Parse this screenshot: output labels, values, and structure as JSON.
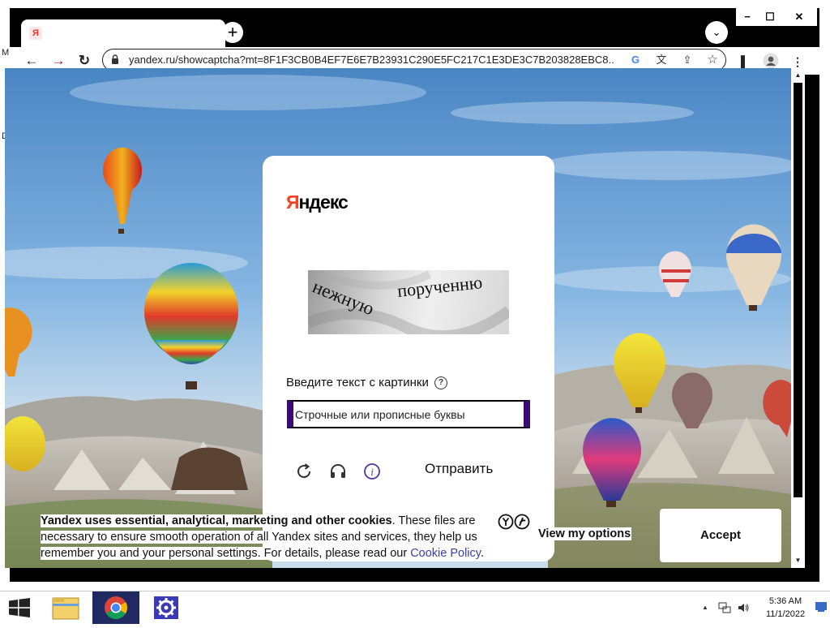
{
  "desktop": {
    "edge_letter_1": "M",
    "edge_letter_2": "D"
  },
  "window": {
    "tab_favicon_letter": "Я",
    "newtab_symbol": "+",
    "tabsearch_symbol": "⌄",
    "minimize_symbol": "−",
    "maximize_symbol": "☐",
    "close_symbol": "✕"
  },
  "toolbar": {
    "back_symbol": "←",
    "forward_symbol": "→",
    "reload_symbol": "↻",
    "url": "yandex.ru/showcaptcha?mt=8F1F3CB0B4EF7E6E7B23931C290E5FC217C1E3DE3C7B203828EBC8...",
    "google_symbol": "G",
    "translate_symbol": "文",
    "share_symbol": "⇪",
    "bookmark_symbol": "☆",
    "sidepanel_symbol": "▌",
    "menu_symbol": "⋮"
  },
  "captcha": {
    "logo_first": "Я",
    "logo_rest": "ндекс",
    "word_1": "нежную",
    "word_2": "порученню",
    "label": "Введите текст с картинки",
    "help_symbol": "?",
    "input_placeholder": "Строчные или прописные буквы",
    "input_value": "",
    "submit_label": "Отправить"
  },
  "cookie": {
    "bold_text": "Yandex uses essential, analytical, marketing and other cookies",
    "body_text": ". These files are necessary to ensure smooth operation of all Yandex sites and services, they help us remember you and your personal settings. For details, please read our ",
    "link_text": "Cookie Policy",
    "end_text": ".",
    "options_label": "View my options",
    "accept_label": "Accept"
  },
  "taskbar": {
    "tray_arrow": "▲",
    "time": "5:36 AM",
    "date": "11/1/2022"
  },
  "colors": {
    "yandex_red": "#fc3f1d",
    "input_border": "#3c0b74",
    "link": "#3b3ea8",
    "sky_top": "#4a86c4"
  }
}
